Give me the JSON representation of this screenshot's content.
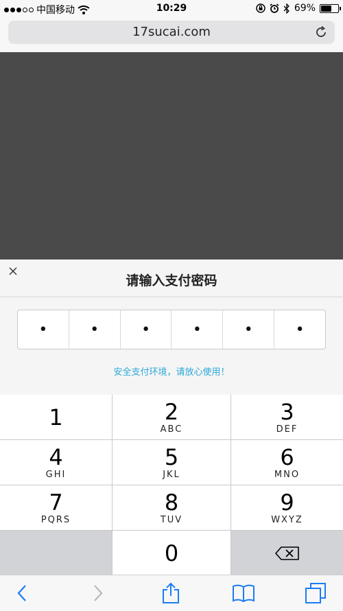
{
  "status_bar": {
    "carrier": "中国移动",
    "time": "10:29",
    "battery": "69%",
    "battery_level": 0.69,
    "icons": [
      "signal-dots-icon",
      "wifi-icon",
      "orientation-lock-icon",
      "alarm-icon",
      "bluetooth-icon",
      "battery-icon"
    ]
  },
  "browser": {
    "url": "17sucai.com",
    "reload_icon": "reload-icon"
  },
  "modal": {
    "close_icon": "close-icon",
    "title": "请输入支付密码",
    "password_cells": [
      "•",
      "•",
      "•",
      "•",
      "•",
      "•"
    ],
    "tip": "安全支付环境，请放心使用！",
    "tip_color": "#2aa7d9"
  },
  "keypad": {
    "keys": [
      {
        "num": "1",
        "letters": ""
      },
      {
        "num": "2",
        "letters": "ABC"
      },
      {
        "num": "3",
        "letters": "DEF"
      },
      {
        "num": "4",
        "letters": "GHI"
      },
      {
        "num": "5",
        "letters": "JKL"
      },
      {
        "num": "6",
        "letters": "MNO"
      },
      {
        "num": "7",
        "letters": "PQRS"
      },
      {
        "num": "8",
        "letters": "TUV"
      },
      {
        "num": "9",
        "letters": "WXYZ"
      },
      {
        "num": "0",
        "letters": ""
      }
    ],
    "delete_icon": "backspace-icon"
  },
  "toolbar": {
    "icons": [
      "back-icon",
      "forward-icon",
      "share-icon",
      "bookmarks-icon",
      "tabs-icon"
    ],
    "accent": "#1a7cf5"
  }
}
